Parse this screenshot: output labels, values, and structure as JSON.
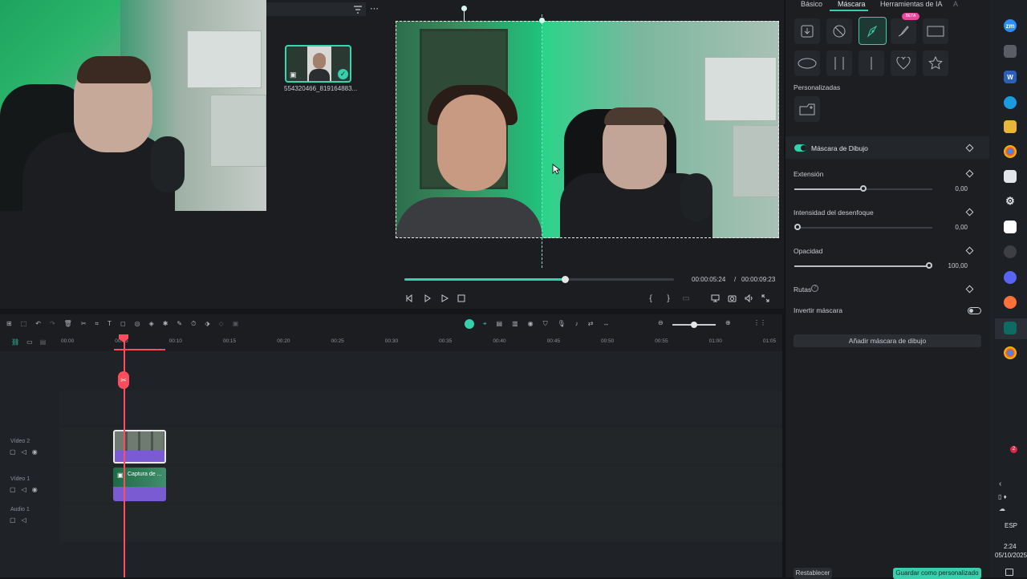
{
  "media": {
    "thumb_name": "554320466_819164883..."
  },
  "player": {
    "current_time": "00:00:05:24",
    "separator": "/",
    "total_time": "00:00:09:23",
    "progress": 0.6
  },
  "panel": {
    "tabs": [
      "Básico",
      "Máscara",
      "Herramientas de IA",
      "A"
    ],
    "active_tab": "Máscara",
    "beta_badge": "BETA",
    "custom_label": "Personalizadas",
    "mask_name": "Máscara de Dibujo",
    "extension": {
      "label": "Extensión",
      "value": "0,00",
      "level": 0.5
    },
    "blur": {
      "label": "Intensidad del desenfoque",
      "value": "0,00",
      "level": 0.0
    },
    "opacity": {
      "label": "Opacidad",
      "value": "100,00",
      "level": 1.0
    },
    "paths_label": "Rutas",
    "invert_label": "Invertir máscara",
    "add_button": "Añadir máscara de dibujo",
    "reset_button": "Restablecer",
    "save_button": "Guardar como personalizado"
  },
  "timeline": {
    "ruler": [
      "00:00",
      "00:05",
      "00:10",
      "00:15",
      "00:20",
      "00:25",
      "00:30",
      "00:35",
      "00:40",
      "00:45",
      "00:50",
      "00:55",
      "01:00",
      "01:05"
    ],
    "tracks": {
      "video2": "Vídeo 2",
      "video1": "Vídeo 1",
      "audio1": "Audio 1"
    },
    "clip_v1_name": "Captura de ..."
  },
  "taskbar": {
    "lang": "ESP",
    "time": "2:24",
    "date": "05/10/2025",
    "notif_count": "2",
    "zoom_label": "zm"
  },
  "colors": {
    "accent": "#36d0ad",
    "playhead": "#ff4d5e",
    "clip": "#7b5bd1"
  }
}
